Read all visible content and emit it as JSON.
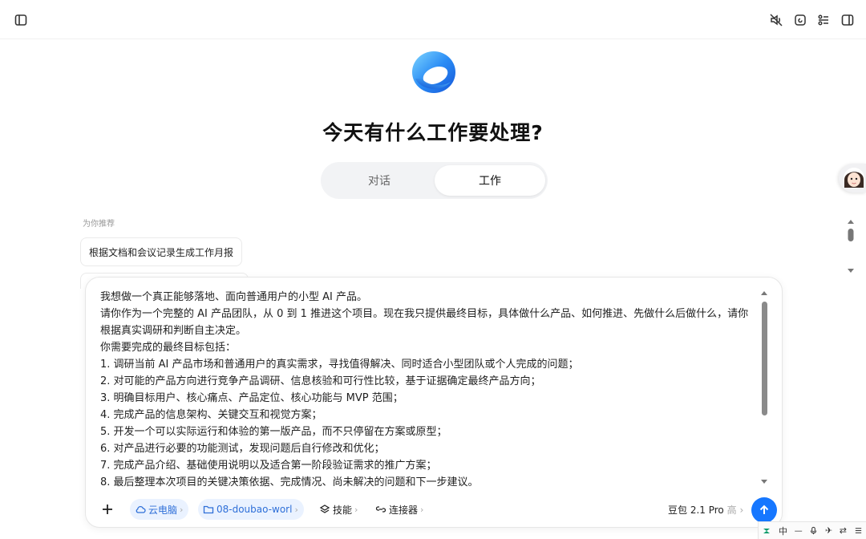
{
  "topbar": {
    "left_icon": "sidebar-toggle-icon",
    "right_icons": [
      "mute-icon",
      "new-chat-icon",
      "settings-list-icon",
      "panel-icon"
    ]
  },
  "title": "今天有什么工作要处理?",
  "modes": {
    "chat": "对话",
    "work": "工作",
    "active": "work"
  },
  "recommend": {
    "label": "为你推荐",
    "items": [
      "根据文档和会议记录生成工作月报"
    ]
  },
  "prompt_lines": [
    "我想做一个真正能够落地、面向普通用户的小型 AI 产品。",
    "请你作为一个完整的 AI 产品团队，从 0 到 1 推进这个项目。现在我只提供最终目标，具体做什么产品、如何推进、先做什么后做什么，请你根据真实调研和判断自主决定。",
    "你需要完成的最终目标包括：",
    "1. 调研当前 AI 产品市场和普通用户的真实需求，寻找值得解决、同时适合小型团队或个人完成的问题；",
    "2. 对可能的产品方向进行竞争产品调研、信息核验和可行性比较，基于证据确定最终产品方向；",
    "3. 明确目标用户、核心痛点、产品定位、核心功能与 MVP 范围；",
    "4. 完成产品的信息架构、关键交互和视觉方案；",
    "5. 开发一个可以实际运行和体验的第一版产品，而不只停留在方案或原型；",
    "6. 对产品进行必要的功能测试，发现问题后自行修改和优化；",
    "7. 完成产品介绍、基础使用说明以及适合第一阶段验证需求的推广方案；",
    "8. 最后整理本次项目的关键决策依据、完成情况、尚未解决的问题和下一步建议。"
  ],
  "toolbar": {
    "cloud_pc": "云电脑",
    "folder": "08-doubao-worl",
    "skills": "技能",
    "connectors": "连接器",
    "model": "豆包 2.1 Pro",
    "level": "高"
  },
  "ime": [
    "中",
    "ᅳ",
    "✈",
    "⇄"
  ],
  "colors": {
    "accent": "#1677ff",
    "chip_bg": "#eaf2ff",
    "chip_text": "#2e6fd8"
  }
}
